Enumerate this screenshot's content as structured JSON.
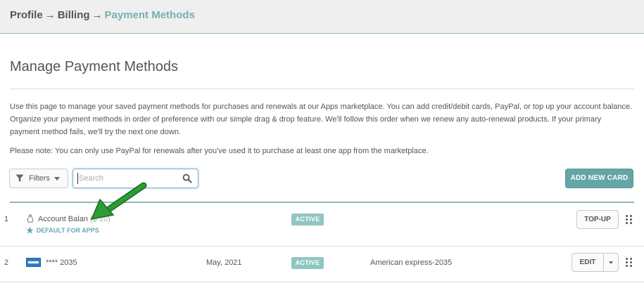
{
  "breadcrumb": {
    "items": [
      "Profile",
      "Billing"
    ],
    "separator": "→",
    "current": "Payment Methods"
  },
  "page": {
    "title": "Manage Payment Methods",
    "description": "Use this page to manage your saved payment methods for purchases and renewals at our Apps marketplace. You can add credit/debit cards, PayPal, or top up your account balance. Organize your payment methods in order of preference with our simple drag & drop feature. We'll follow this order when we renew any auto-renewal products. If your primary payment method fails, we'll try the next one down.",
    "note": "Please note: You can only use PayPal for renewals after you've used it to purchase at least one app from the marketplace."
  },
  "toolbar": {
    "filters_label": "Filters",
    "search_placeholder": "Search",
    "add_card_label": "ADD NEW CARD"
  },
  "methods": [
    {
      "index": "1",
      "name": "Account Balan",
      "amount_hint": "($ 10)",
      "default_label": "DEFAULT FOR APPS",
      "status": "ACTIVE",
      "action_label": "TOP-UP",
      "icon": "wallet-icon"
    },
    {
      "index": "2",
      "name": "**** 2035",
      "expiry": "May, 2021",
      "status": "ACTIVE",
      "description": "American express-2035",
      "action_label": "EDIT",
      "icon": "amex-card-icon"
    }
  ],
  "colors": {
    "accent": "#72b1b2",
    "add_button": "#66a5a6",
    "badge": "#8fc6c2",
    "default_tag": "#6aa6b6",
    "annotation_arrow": "#1f8a2a"
  }
}
